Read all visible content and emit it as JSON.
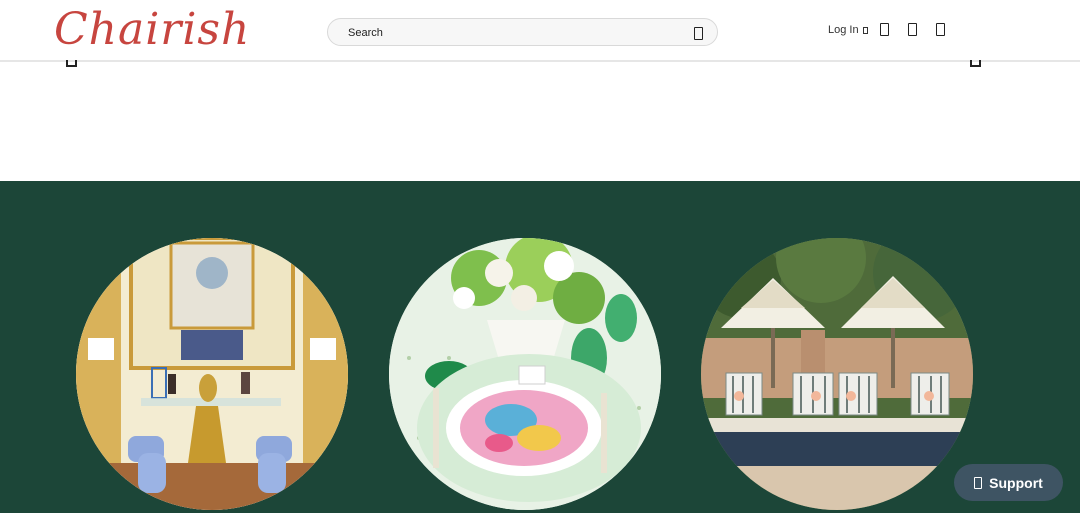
{
  "header": {
    "logo_text": "Chairish",
    "search": {
      "placeholder": "Search"
    },
    "login_label": "Log In",
    "icons": [
      "heart-icon",
      "cart-icon",
      "menu-icon"
    ]
  },
  "hero": {
    "background_color": "#1c4638",
    "circles": [
      {
        "name": "gilded-room-interior"
      },
      {
        "name": "tablescape-place-setting"
      },
      {
        "name": "poolside-umbrellas"
      }
    ]
  },
  "support": {
    "label": "Support"
  },
  "colors": {
    "brand": "#c7453f",
    "hero_green": "#1c4638",
    "support_bg": "#3e5463"
  }
}
